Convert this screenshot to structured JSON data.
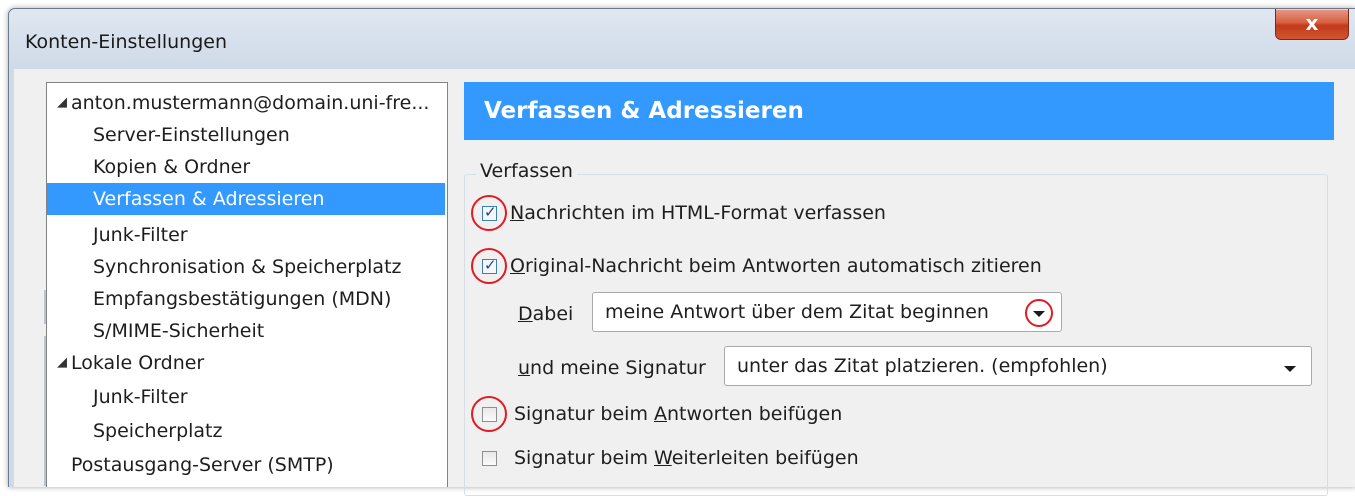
{
  "window": {
    "title": "Konten-Einstellungen",
    "close_label": "x"
  },
  "tree": {
    "items": [
      {
        "label": "anton.mustermann@domain.uni-fre...",
        "expanded": true
      },
      {
        "label": "Server-Einstellungen"
      },
      {
        "label": "Kopien & Ordner"
      },
      {
        "label": "Verfassen & Adressieren",
        "selected": true
      },
      {
        "label": "Junk-Filter"
      },
      {
        "label": "Synchronisation & Speicherplatz"
      },
      {
        "label": "Empfangsbestätigungen (MDN)"
      },
      {
        "label": "S/MIME-Sicherheit"
      },
      {
        "label": "Lokale Ordner",
        "expanded": true
      },
      {
        "label": "Junk-Filter"
      },
      {
        "label": "Speicherplatz"
      },
      {
        "label": "Postausgang-Server (SMTP)"
      }
    ],
    "expander_glyph": "◢"
  },
  "panel": {
    "header": "Verfassen & Adressieren",
    "group_label": "Verfassen",
    "html_format": {
      "pre": "",
      "accel": "N",
      "post": "achrichten im HTML-Format verfassen",
      "checked": true
    },
    "quote_original": {
      "pre": "",
      "accel": "O",
      "post": "riginal-Nachricht beim Antworten automatisch zitieren",
      "checked": true
    },
    "dabei": {
      "accel": "D",
      "post": "abei",
      "value": "meine Antwort über dem Zitat beginnen"
    },
    "signature_pos": {
      "accel": "u",
      "post": "nd meine Signatur",
      "value": "unter das Zitat platzieren. (empfohlen)"
    },
    "sig_reply": {
      "pre": "Signatur beim ",
      "accel": "A",
      "post": "ntworten beifügen",
      "checked": false
    },
    "sig_forward": {
      "pre": "Signatur beim ",
      "accel": "W",
      "post": "eiterleiten beifügen",
      "checked": false
    }
  },
  "colors": {
    "selection": "#3399ff",
    "annotation_ring": "#e21b23",
    "close_button": "#c2391b"
  }
}
